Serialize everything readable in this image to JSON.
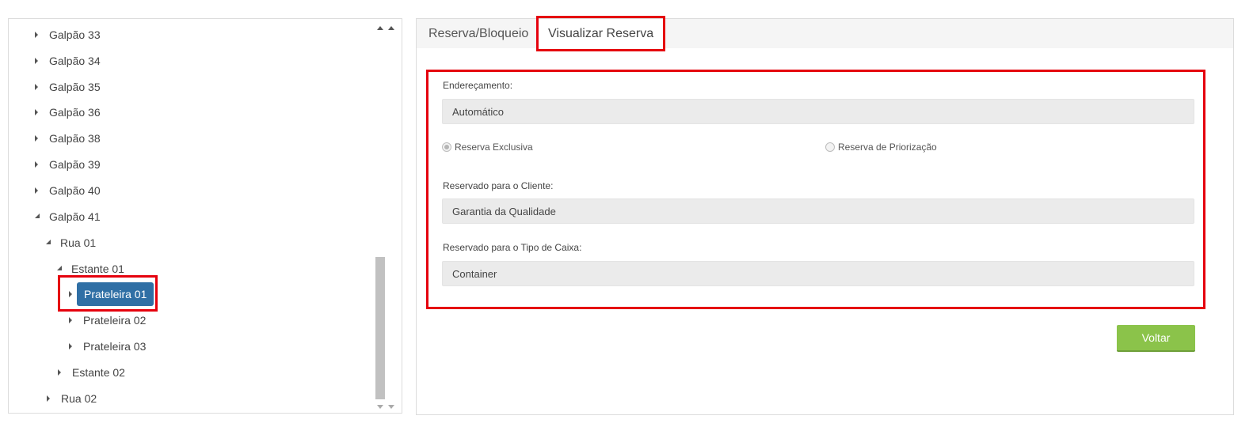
{
  "tree": {
    "nodes": [
      {
        "label": "Galpão 33",
        "state": "collapsed"
      },
      {
        "label": "Galpão 34",
        "state": "collapsed"
      },
      {
        "label": "Galpão 35",
        "state": "collapsed"
      },
      {
        "label": "Galpão 36",
        "state": "collapsed"
      },
      {
        "label": "Galpão 38",
        "state": "collapsed"
      },
      {
        "label": "Galpão 39",
        "state": "collapsed"
      },
      {
        "label": "Galpão 40",
        "state": "collapsed"
      },
      {
        "label": "Galpão 41",
        "state": "expanded"
      },
      {
        "label": "Rua 01",
        "state": "expanded"
      },
      {
        "label": "Estante 01",
        "state": "expanded"
      },
      {
        "label": "Prateleira 01",
        "state": "collapsed",
        "selected": true
      },
      {
        "label": "Prateleira 02",
        "state": "collapsed"
      },
      {
        "label": "Prateleira 03",
        "state": "collapsed"
      },
      {
        "label": "Estante 02",
        "state": "collapsed"
      },
      {
        "label": "Rua 02",
        "state": "collapsed"
      }
    ]
  },
  "tabs": [
    {
      "label": "Reserva/Bloqueio",
      "active": false
    },
    {
      "label": "Visualizar Reserva",
      "active": true
    }
  ],
  "form": {
    "enderecamento_label": "Endereçamento:",
    "enderecamento_value": "Automático",
    "radio_exclusiva_label": "Reserva Exclusiva",
    "radio_exclusiva_checked": true,
    "radio_priorizacao_label": "Reserva de Priorização",
    "radio_priorizacao_checked": false,
    "cliente_label": "Reservado para o Cliente:",
    "cliente_value": "Garantia da Qualidade",
    "tipo_caixa_label": "Reservado para o Tipo de Caixa:",
    "tipo_caixa_value": "Container"
  },
  "buttons": {
    "voltar_label": "Voltar"
  },
  "colors": {
    "highlight": "#e5000d",
    "selected_node": "#2f6fa5",
    "voltar_button": "#8bc34a"
  }
}
